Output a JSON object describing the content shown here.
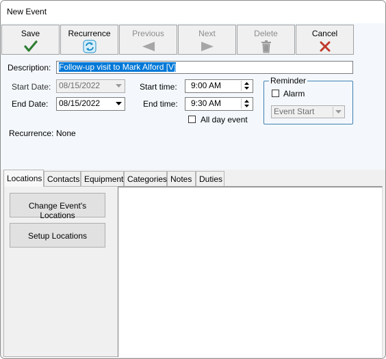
{
  "window": {
    "title": "New Event"
  },
  "toolbar": {
    "save": "Save",
    "recurrence": "Recurrence",
    "previous": "Previous",
    "next": "Next",
    "delete": "Delete",
    "cancel": "Cancel"
  },
  "form": {
    "description_label": "Description:",
    "description_value": "Follow-up visit to Mark Alford [V]",
    "start_date_label": "Start Date:",
    "start_date_value": "08/15/2022",
    "end_date_label": "End Date:",
    "end_date_value": "08/15/2022",
    "start_time_label": "Start time:",
    "start_time_value": "9:00 AM",
    "end_time_label": "End time:",
    "end_time_value": "9:30 AM",
    "all_day_label": "All day event",
    "all_day_checked": false,
    "recurrence_label": "Recurrence:",
    "recurrence_value": "None"
  },
  "reminder": {
    "title": "Reminder",
    "alarm_label": "Alarm",
    "alarm_checked": false,
    "timing_value": "Event Start"
  },
  "tabs": [
    "Locations",
    "Contacts",
    "Equipment",
    "Categories",
    "Notes",
    "Duties"
  ],
  "locations_tab": {
    "change_button": "Change Event's Locations",
    "setup_button": "Setup Locations"
  },
  "colors": {
    "selection": "#0078d7",
    "save_check": "#2e7d32",
    "cancel_x": "#c0392b",
    "recurrence_icon": "#1e90c8",
    "group_border": "#3c7fb1"
  }
}
